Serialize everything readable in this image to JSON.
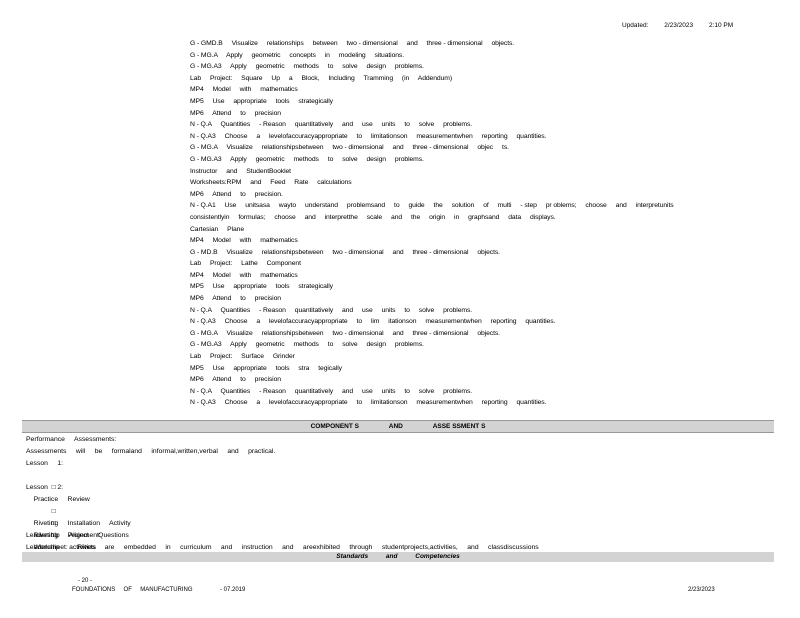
{
  "header": {
    "label": "Updated:",
    "date": "2/23/2023",
    "time": "2:10 PM"
  },
  "standards_lines": [
    "G - GMD.B     Visualize     relationships     between     two - dimensional     and     three - dimensional     objects.",
    "G - MG.A     Apply     geometric     concepts     in     modeling     situations.",
    "G - MG.A3     Apply     geometric     methods     to     solve     design     problems.",
    "Lab     Project:     Square     Up     a     Block,     Including     Tramming     (in     Addendum)",
    "MP4     Model     with     mathematics",
    "MP5     Use     appropriate     tools     strategically",
    "MP6     Attend     to     precision",
    "N - Q.A     Quantities     - Reason     quantitatively     and     use     units     to     solve     problems.",
    "N - Q.A3     Choose     a     levelofaccuracyappropriate     to     limitationson     measurementwhen     reporting     quantities.",
    "G - MG.A     Visualize     relationshipsbetween     two - dimensional     and     three - dimensional     objec     ts.",
    "G - MG.A3     Apply     geometric     methods     to     solve     design     problems.",
    "Instructor     and     StudentBooklet",
    "Worksheets:RPM     and     Feed     Rate     calculations",
    "MP6     Attend     to     precision.",
    "N - Q.A1     Use     unitsasa     wayto     understand     problemsand     to     guide     the     solution     of     multi     - step     pr oblems;     choose     and     interpretunits",
    "consistentlyin     formulas;     choose     and     interpretthe     scale     and     the     origin     in     graphsand     data     displays.",
    "Cartesian     Plane",
    "MP4     Model     with     mathematics",
    "G - MD.B     Visualize     relationshipsbetween     two - dimensional     and     three - dimensional     objects.",
    "Lab     Project:     Lathe     Component",
    "MP4     Model     with     mathematics",
    "MP5     Use     appropriate     tools     strategically",
    "MP6     Attend     to     precision",
    "N - Q.A     Quantities     - Reason     quantitatively     and     use     units     to     solve     problems.",
    "N - Q.A3     Choose     a     levelofaccuracyappropriate     to     lim     itationson     measurementwhen     reporting     quantities.",
    "G - MG.A     Visualize     relationshipsbetween     two - dimensional     and     three - dimensional     objects.",
    "G - MG.A3     Apply     geometric     methods     to     solve     design     problems.",
    "Lab     Project:     Surface     Grinder",
    "MP5     Use     appropriate     tools     stra     tegically",
    "MP6     Attend     to     precision",
    "N - Q.A     Quantities     - Reason     quantitatively     and     use     units     to     solve     problems.",
    "N - Q.A3     Choose     a     levelofaccuracyappropriate     to     limitationson     measurementwhen     reporting     quantities."
  ],
  "components_bar": {
    "word1": "COMPONENT S",
    "word2": "AND",
    "word3": "ASSE SSMENT S"
  },
  "performance": {
    "heading": "Performance     Assessments:",
    "assessments_line": "Assessments     will     be     formaland     informal,written,verbal     and     practical.",
    "lesson1": "Lesson     1:",
    "lesson1_items": [
      "Practice     Review"
    ],
    "lesson2": "Lesson     2:",
    "lesson2_items": [
      "Riveting     Installation     Activity",
      "Riveting     Project     Questions"
    ],
    "worksheet_prefix": "Worksheet:     Rivets",
    "worksheet_title": "– What’s the Chance?",
    "leadership_heading": "Leadership     Alignment:",
    "leadership_line": "Leadership     activities     are     embedded     in     curriculum     and     instruction     and     areexhibited     through     studentprojects,activities,     and     classdiscussions"
  },
  "standards_bar": {
    "word1": "Standards",
    "word2": "and",
    "word3": "Competencies"
  },
  "footer": {
    "page": "- 20 -",
    "course": "FOUNDATIONS     OF     MANUFACTURING",
    "version": "- 07.2019",
    "date": "2/23/2023"
  }
}
